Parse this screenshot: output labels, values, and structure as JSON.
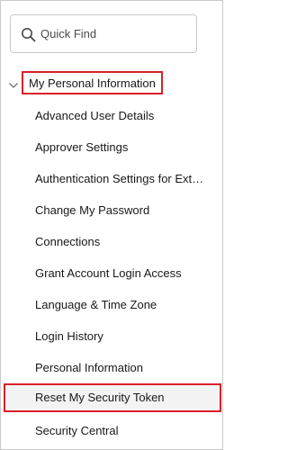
{
  "search": {
    "placeholder": "Quick Find",
    "value": ""
  },
  "section": {
    "label": "My Personal Information",
    "expanded": true
  },
  "items": [
    "Advanced User Details",
    "Approver Settings",
    "Authentication Settings for Ext…",
    "Change My Password",
    "Connections",
    "Grant Account Login Access",
    "Language & Time Zone",
    "Login History",
    "Personal Information",
    "Reset My Security Token",
    "Security Central"
  ],
  "highlighted_item_index": 9,
  "colors": {
    "highlight_border": "#d8202a",
    "selected_background": "#f3f3f3",
    "border": "#c9c9c9",
    "text": "#181818"
  }
}
